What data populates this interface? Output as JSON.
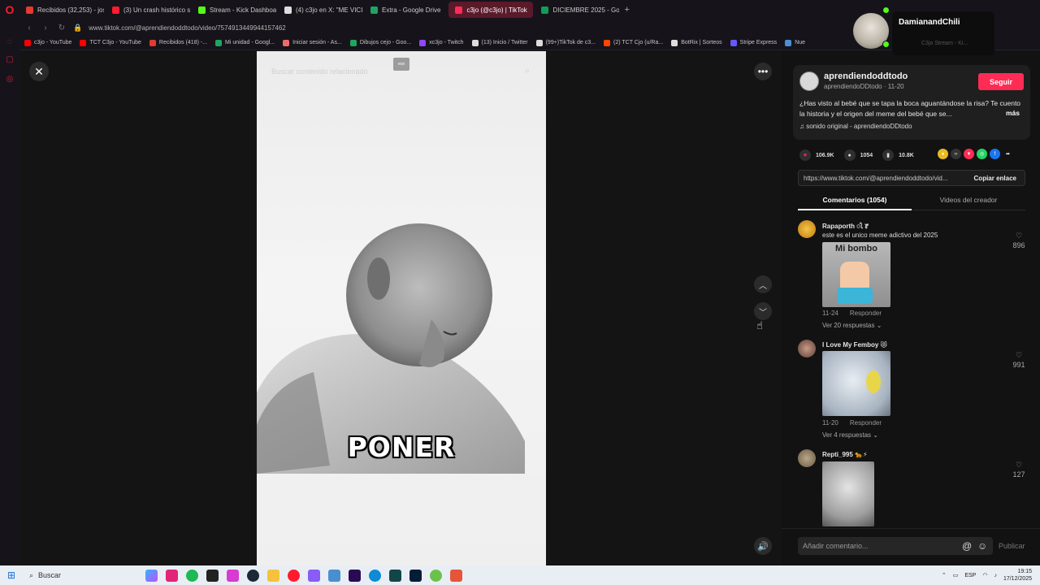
{
  "browser": {
    "tabs": [
      {
        "label": "Recibidos (32,253) - jose",
        "color": "#e33b2e",
        "active": false
      },
      {
        "label": "(3) Un crash histórico se",
        "color": "#ff1b2d",
        "active": false
      },
      {
        "label": "Stream - Kick Dashboard",
        "color": "#53fc18",
        "active": false
      },
      {
        "label": "(4) c3jo en X: \"ME VICI",
        "color": "#dddddd",
        "active": false
      },
      {
        "label": "Extra - Google Drive",
        "color": "#1fa463",
        "active": false
      },
      {
        "label": "c3jo (@c3jo) | TikTok",
        "color": "#fe2c55",
        "active": true
      },
      {
        "label": "DICIEMBRE 2025 - Googl",
        "color": "#0f9d58",
        "active": false
      }
    ],
    "new_tab": "+",
    "url": "www.tiktok.com/@aprendiendoddtodo/video/7574913449944157462",
    "bookmarks": [
      {
        "label": "c3jo - YouTube",
        "color": "#ff0000"
      },
      {
        "label": "TCT C3jo - YouTube",
        "color": "#ff0000"
      },
      {
        "label": "Recibidos (418) -...",
        "color": "#e33b2e"
      },
      {
        "label": "Mi unidad - Googl...",
        "color": "#1fa463"
      },
      {
        "label": "Iniciar sesión - As...",
        "color": "#f06a6a"
      },
      {
        "label": "Dibujos cejo - Goo...",
        "color": "#1fa463"
      },
      {
        "label": "xc3jo - Twitch",
        "color": "#9146ff"
      },
      {
        "label": "(13) Inicio / Twitter",
        "color": "#dddddd"
      },
      {
        "label": "(99+)TikTok de c3...",
        "color": "#dddddd"
      },
      {
        "label": "(2) TCT Cjo (u/Ra...",
        "color": "#ff4500"
      },
      {
        "label": "BotRix | Sorteos",
        "color": "#dddddd"
      },
      {
        "label": "Stripe Express",
        "color": "#635bff"
      },
      {
        "label": "Nue",
        "color": "#4a90d9"
      }
    ]
  },
  "video": {
    "search_placeholder": "Buscar contenido relacionado",
    "badge": "eox",
    "caption": "PONER"
  },
  "panel": {
    "author_name": "aprendiendoddtodo",
    "author_sub": "aprendiendoDDtodo · 11-20",
    "follow": "Seguir",
    "description": "¿Has visto al bebé que se tapa la boca aguantándose la risa? Te cuento la historia y el origen del meme del bebé que se...",
    "description_more": "más",
    "sound": "sonido original - aprendiendoDDtodo",
    "likes": "106.9K",
    "comments": "1054",
    "saves": "10.8K",
    "link": "https://www.tiktok.com/@aprendiendoddtodo/vid...",
    "copy": "Copiar enlace",
    "tab_comments": "Comentarios (1054)",
    "tab_creator": "Videos del creador",
    "comment_placeholder": "Añadir comentario...",
    "publish": "Publicar"
  },
  "comments": [
    {
      "user": "Rapaporth ꢷ ꢸ",
      "text": "este es el unico meme adictivo del 2025",
      "image_label": "Mi bombo",
      "date": "11-24",
      "reply": "Responder",
      "replies": "Ver 20 respuestas",
      "likes": "896"
    },
    {
      "user": "I Love My Femboy 😻",
      "text": "",
      "image_label": "",
      "date": "11-20",
      "reply": "Responder",
      "replies": "Ver 4 respuestas",
      "likes": "991"
    },
    {
      "user": "Repti_995 🐆⚡",
      "text": "",
      "image_label": "",
      "date": "",
      "reply": "",
      "replies": "",
      "likes": "127"
    }
  ],
  "overlay": {
    "streamer_name": "DamianandChili",
    "streamer_sub": "C3jo Stream - Ki..."
  },
  "taskbar": {
    "search": "Buscar",
    "lang": "ESP",
    "time": "19:15",
    "date": "17/12/2025"
  },
  "colors": {
    "accent": "#fe2c55",
    "kick_green": "#53fc18"
  }
}
